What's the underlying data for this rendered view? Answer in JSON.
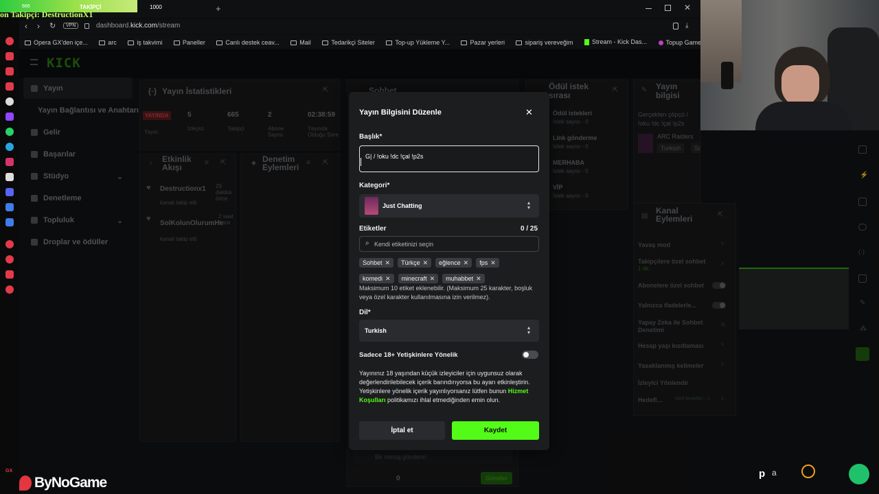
{
  "browser": {
    "overlay_text": "on Takipçi: DestructionX1",
    "overlay_stats": [
      "666",
      "TAKİPÇİ",
      "1000"
    ],
    "new_tab": "+",
    "vpn": "VPN",
    "url_domain": "dashboard.",
    "url_host": "kick.com",
    "url_path": "/stream",
    "bookmarks": [
      "Opera GX'den içe...",
      "arc",
      "iş takvimi",
      "Paneller",
      "Canlı destek ceav...",
      "Mail",
      "Tedarikçi Siteler",
      "Top-up Yükleme Y...",
      "Pazar yerleri",
      "sipariş vereveğim",
      "Stream - Kick Das...",
      "Topup Game Mura..."
    ]
  },
  "dashboard": {
    "logo": "KICK",
    "nav": [
      "Yayın",
      "Yayın Bağlantısı ve Anahtarı",
      "Gelir",
      "Başarılar",
      "Stüdyo",
      "Denetleme",
      "Topluluk",
      "Droplar ve ödüller"
    ],
    "stats_panel": {
      "title": "Yayın İstatistikleri",
      "live_badge": "YAYINDA",
      "live_sub": "Yayın",
      "viewers": "5",
      "viewers_label": "İzleyici",
      "followers": "665",
      "followers_label": "Takipçi",
      "subs": "2",
      "subs_label": "Abone Sayısı",
      "uptime": "02:38:59",
      "uptime_label": "Yayında Olduğu Süre"
    },
    "activity": {
      "title": "Etkinlik Akışı",
      "items": [
        {
          "name": "Destructionx1",
          "sub": "kanalı takip etti",
          "time": "29 dakika önce"
        },
        {
          "name": "SolKolunOlurumHe",
          "sub": "kanalı takip etti",
          "time": "2 saat önce"
        }
      ]
    },
    "moderation": {
      "title": "Denetim Eylemleri"
    },
    "chat": {
      "title": "Sohbet",
      "placeholder": "Bir mesaj gönderin",
      "send": "Gönder",
      "count": "0"
    },
    "rewards": {
      "title": "Ödül istek sırası",
      "items": [
        {
          "name": "Ödül istekleri",
          "sub": "İstek sayısı - 0"
        },
        {
          "name": "Link gönderme",
          "sub": "İstek sayısı - 0"
        },
        {
          "name": "MERHABA",
          "sub": "İstek sayısı - 0"
        },
        {
          "name": "VİP",
          "sub": "İstek sayısı - 0"
        }
      ]
    },
    "stream_info": {
      "title": "Yayın bilgisi",
      "current_title": "Gerçekten çöpçü / !oku !dc !çal !p2s",
      "game": "ARC Raiders",
      "tags": [
        "Turkish",
        "Sohbet"
      ]
    },
    "channel_actions": {
      "title": "Kanal Eylemleri",
      "items": [
        "Yavaş mod",
        "Takipçilere özel sohbet",
        "Abonelere özel sohbet",
        "Yalnızca ifadelerle...",
        "Yapay Zeka ile Sohbet Denetimi",
        "Hesap yaşı kısıtlaması",
        "Yasaklanmış kelimeler",
        "İzleyici Yönlendir",
        "Hedefl..."
      ],
      "follower_sub": "1 dk.",
      "target_sub": "Aktif hedefler - 1"
    }
  },
  "modal": {
    "title": "Yayın Bilgisini Düzenle",
    "title_label": "Başlık*",
    "title_value": "G| / !oku !dc !çal !p2s",
    "category_label": "Kategori*",
    "category_value": "Just Chatting",
    "tags_label": "Etiketler",
    "tags_count": "0 / 25",
    "tags_placeholder": "Kendi etiketinizi seçin",
    "tags": [
      "Sohbet",
      "Türkçe",
      "eğlence",
      "fps",
      "komedi",
      "minecraft",
      "muhabbet"
    ],
    "tags_help": "Maksimum 10 etiket eklenebilir. (Maksimum 25 karakter, boşluk veya özel karakter kullanılmasına izin verilmez).",
    "lang_label": "Dil*",
    "lang_value": "Turkish",
    "adult_label": "Sadece 18+ Yetişkinlere Yönelik",
    "adult_help_1": "Yayınınız 18 yaşından küçük izleyiciler için uygunsuz olarak değerlendirilebilecek içerik barındırıyorsa bu ayarı etkinleştirin. Yetişkinlere yönelik içerik yayınlıyorsanız lütfen bunun ",
    "adult_help_link": "Hizmet Koşulları",
    "adult_help_2": " politikamızı ihlal etmediğinden emin olun.",
    "cancel": "İptal et",
    "save": "Kaydet"
  },
  "branding": {
    "name": "ByNoGame"
  },
  "colors": {
    "accent": "#53fc18",
    "modal_bg": "#1c1d1f",
    "field_bg": "#2a2b2e"
  }
}
